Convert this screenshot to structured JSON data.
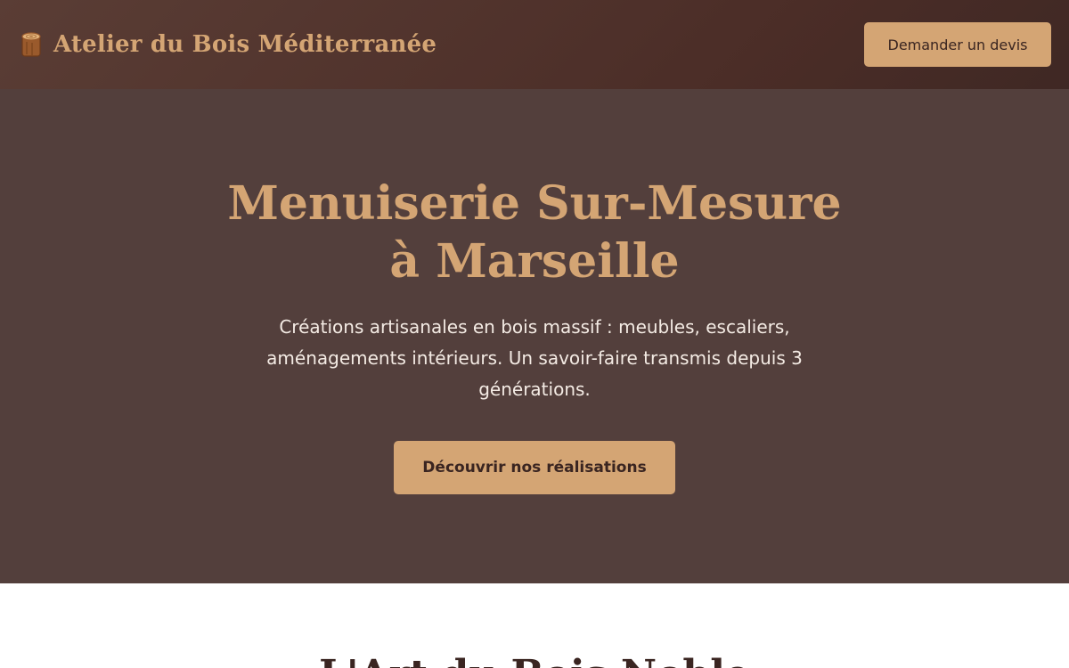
{
  "header": {
    "brand_name": "Atelier du Bois Méditerranée",
    "brand_icon": "wood-log-icon",
    "cta_label": "Demander un devis"
  },
  "hero": {
    "title_line1": "Menuiserie Sur-Mesure",
    "title_line2": "à Marseille",
    "subtitle": "Créations artisanales en bois massif : meubles, escaliers, aménagements intérieurs. Un savoir-faire transmis depuis 3 générations.",
    "button_label": "Découvrir nos réalisations"
  },
  "section": {
    "title": "L'Art du Bois Noble"
  },
  "colors": {
    "accent": "#d4a574",
    "hero_bg": "#533f3c",
    "header_bg": "#4b2d27",
    "dark_text": "#3a2521"
  }
}
